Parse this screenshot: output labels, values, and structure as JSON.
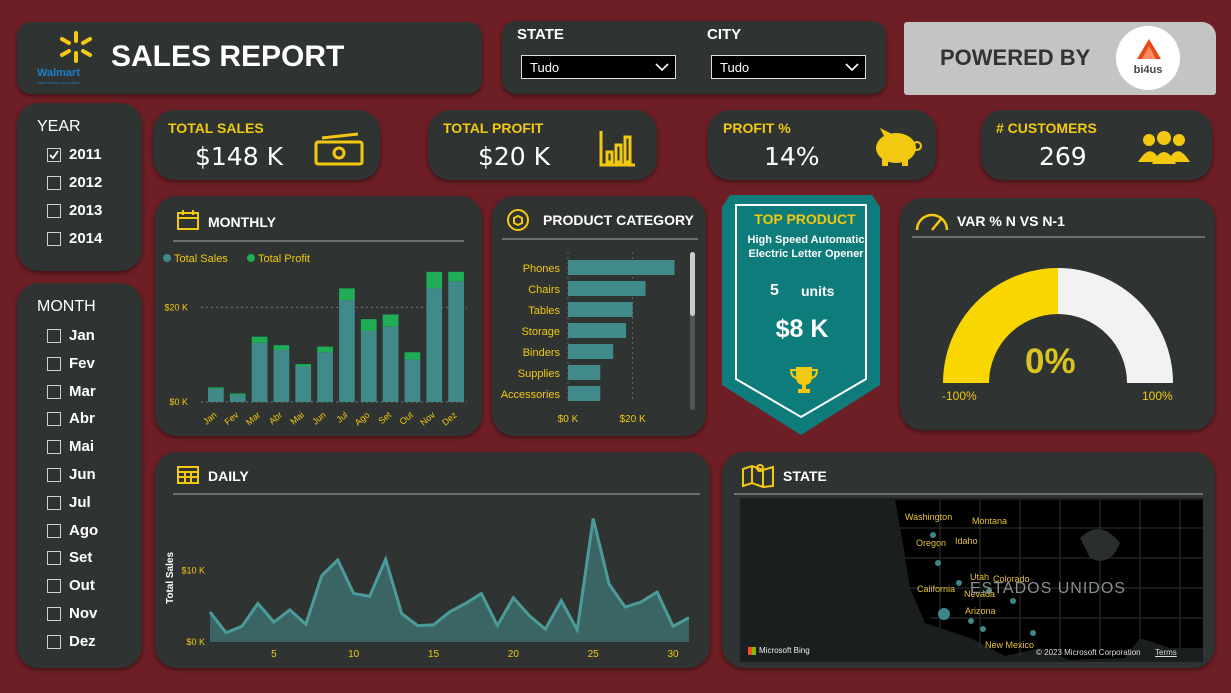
{
  "header": {
    "logo_text": "Walmart",
    "logo_tagline": "Save money. Live better.",
    "title": "SALES REPORT"
  },
  "filters": {
    "state_label": "STATE",
    "state_value": "Tudo",
    "city_label": "CITY",
    "city_value": "Tudo"
  },
  "powered": {
    "label": "POWERED BY",
    "logo_text": "bi4us"
  },
  "year_slicer": {
    "title": "YEAR",
    "items": [
      {
        "label": "2011",
        "checked": true
      },
      {
        "label": "2012",
        "checked": false
      },
      {
        "label": "2013",
        "checked": false
      },
      {
        "label": "2014",
        "checked": false
      }
    ]
  },
  "month_slicer": {
    "title": "MONTH",
    "items": [
      "Jan",
      "Fev",
      "Mar",
      "Abr",
      "Mai",
      "Jun",
      "Jul",
      "Ago",
      "Set",
      "Out",
      "Nov",
      "Dez"
    ]
  },
  "kpis": {
    "total_sales": {
      "label": "TOTAL SALES",
      "value": "$148 K"
    },
    "total_profit": {
      "label": "TOTAL PROFIT",
      "value": "$20 K"
    },
    "profit_pct": {
      "label": "PROFIT %",
      "value": "14%"
    },
    "customers": {
      "label": "# CUSTOMERS",
      "value": "269"
    }
  },
  "top_product": {
    "title": "TOP PRODUCT",
    "name": "High Speed Automatic Electric Letter Opener",
    "units_value": "5",
    "units_label": "units",
    "value": "$8 K"
  },
  "gauge": {
    "title": "VAR % N VS N-1",
    "value_label": "0%",
    "min_label": "-100%",
    "max_label": "100%",
    "value_fraction": 0.5,
    "fill_color": "#f9d600",
    "track_color": "#f2f2f2"
  },
  "map": {
    "title": "STATE",
    "country_label": "ESTADOS UNIDOS",
    "bing_label": "Microsoft Bing",
    "copyright": "© 2023 Microsoft Corporation",
    "terms": "Terms",
    "state_labels": [
      "Washington",
      "Montana",
      "Oregon",
      "Idaho",
      "Utah",
      "Colorado",
      "California",
      "Nevada",
      "Arizona",
      "New Mexico"
    ]
  },
  "colors": {
    "card": "#2f3433",
    "teal": "#418a8a",
    "green": "#1fae55",
    "accent": "#f2c811",
    "background": "#6e1f25"
  },
  "chart_data": [
    {
      "id": "monthly",
      "type": "bar",
      "title": "MONTHLY",
      "categories": [
        "Jan",
        "Fev",
        "Mar",
        "Abr",
        "Mai",
        "Jun",
        "Jul",
        "Ago",
        "Set",
        "Out",
        "Nov",
        "Dez"
      ],
      "series": [
        {
          "name": "Total Sales",
          "color": "#418a8a",
          "values": [
            2.8,
            1.5,
            12.5,
            11.0,
            7.5,
            10.5,
            21.5,
            15.0,
            16.0,
            9.0,
            24.0,
            25.5
          ]
        },
        {
          "name": "Total Profit",
          "color": "#1fae55",
          "values": [
            0.3,
            0.3,
            1.3,
            1.0,
            0.5,
            1.2,
            2.5,
            2.5,
            2.5,
            1.5,
            3.5,
            2.0
          ]
        }
      ],
      "stacked": true,
      "yticks": [
        "$0 K",
        "$20 K"
      ],
      "ylim": [
        0,
        30
      ],
      "grid": true,
      "legend": "top-left"
    },
    {
      "id": "product_category",
      "type": "bar",
      "orientation": "horizontal",
      "title": "PRODUCT CATEGORY",
      "categories": [
        "Phones",
        "Chairs",
        "Tables",
        "Storage",
        "Binders",
        "Supplies",
        "Accessories"
      ],
      "values": [
        33,
        24,
        20,
        18,
        14,
        10,
        10
      ],
      "xticks": [
        "$0 K",
        "$20 K"
      ],
      "xlim": [
        0,
        35
      ],
      "color": "#418a8a"
    },
    {
      "id": "daily",
      "type": "area",
      "title": "DAILY",
      "ylabel": "Total Sales",
      "x": [
        1,
        2,
        3,
        4,
        5,
        6,
        7,
        8,
        9,
        10,
        11,
        12,
        13,
        14,
        15,
        16,
        17,
        18,
        19,
        20,
        21,
        22,
        23,
        24,
        25,
        26,
        27,
        28,
        29,
        30,
        31
      ],
      "values": [
        4.2,
        1.3,
        2.2,
        5.4,
        2.8,
        4.5,
        2.5,
        9.3,
        11.5,
        6.8,
        6.4,
        11.6,
        4.0,
        2.3,
        2.4,
        4.2,
        5.4,
        6.8,
        2.3,
        6.2,
        3.7,
        1.8,
        5.8,
        1.7,
        17.3,
        8.1,
        4.9,
        5.6,
        7.0,
        2.2,
        3.4
      ],
      "xticks": [
        5,
        10,
        15,
        20,
        25,
        30
      ],
      "yticks": [
        "$0 K",
        "$10 K"
      ],
      "ylim": [
        0,
        18.5
      ],
      "color": "#418a8a"
    }
  ]
}
